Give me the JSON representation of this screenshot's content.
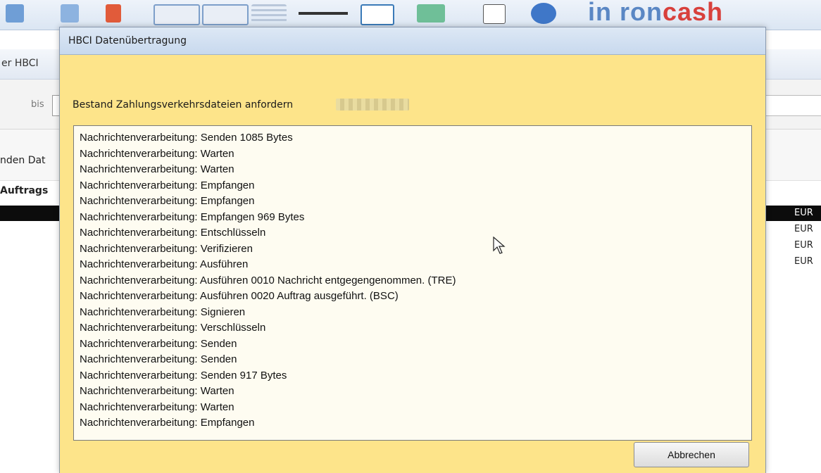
{
  "background": {
    "brand_prefix": "in ron",
    "brand_suffix": "cash",
    "window_caption": "er HBCI",
    "filter_label": "bis",
    "send_label": "nden Dat",
    "column_header": "Auftrags",
    "currency_rows": [
      "EUR",
      "EUR",
      "EUR",
      "EUR"
    ]
  },
  "dialog": {
    "title": "HBCI Datenübertragung",
    "request_label": "Bestand Zahlungsverkehrsdateien anfordern",
    "log_lines": [
      "Nachrichtenverarbeitung: Senden 1085 Bytes",
      "Nachrichtenverarbeitung: Warten",
      "Nachrichtenverarbeitung: Warten",
      "Nachrichtenverarbeitung: Empfangen",
      "Nachrichtenverarbeitung: Empfangen",
      "Nachrichtenverarbeitung: Empfangen 969 Bytes",
      "Nachrichtenverarbeitung: Entschlüsseln",
      "Nachrichtenverarbeitung: Verifizieren",
      "Nachrichtenverarbeitung: Ausführen",
      "Nachrichtenverarbeitung: Ausführen 0010 Nachricht entgegengenommen. (TRE)",
      "Nachrichtenverarbeitung: Ausführen 0020 Auftrag ausgeführt. (BSC)",
      "Nachrichtenverarbeitung: Signieren",
      "Nachrichtenverarbeitung: Verschlüsseln",
      "Nachrichtenverarbeitung: Senden",
      "Nachrichtenverarbeitung: Senden",
      "Nachrichtenverarbeitung: Senden 917 Bytes",
      "Nachrichtenverarbeitung: Warten",
      "Nachrichtenverarbeitung: Warten",
      "Nachrichtenverarbeitung: Empfangen"
    ],
    "cancel_label": "Abbrechen"
  },
  "colors": {
    "dialog_bg": "#fde48a",
    "log_bg": "#fefcf1",
    "titlebar": "#c8d9ee",
    "selected_row": "#0c0c0c"
  }
}
